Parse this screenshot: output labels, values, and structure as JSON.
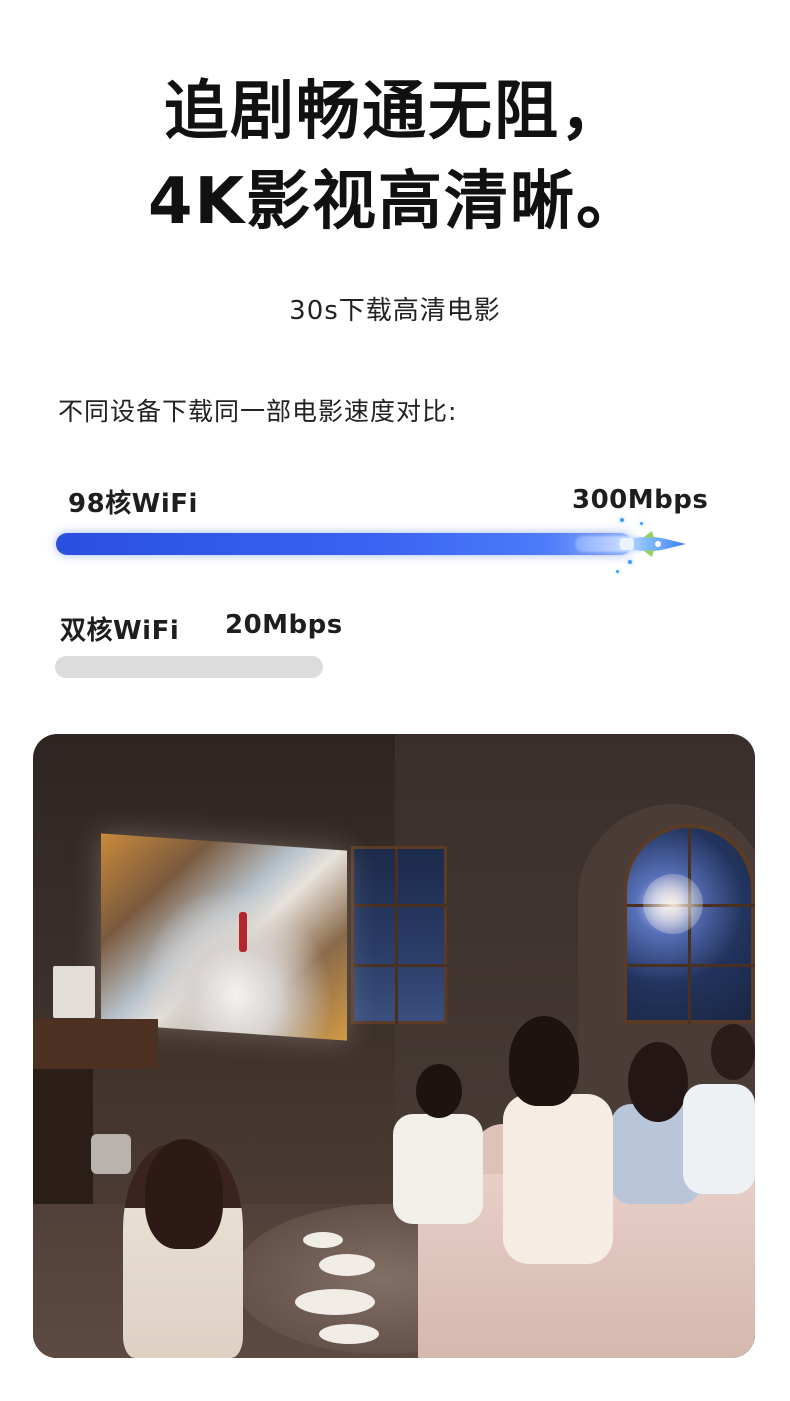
{
  "headline": {
    "line1": "追剧畅通无阻，",
    "line2": "4K影视高清晰。"
  },
  "subtitle": "30s下载高清电影",
  "comparison": {
    "label": "不同设备下载同一部电影速度对比:",
    "fast": {
      "name": "98核WiFi",
      "speed": "300Mbps",
      "color": "#3a63f2",
      "icon": "rocket-icon"
    },
    "slow": {
      "name": "双核WiFi",
      "speed": "20Mbps",
      "color": "#dcdcdc"
    }
  },
  "photo": {
    "description_icon": "home-theater-photo"
  }
}
